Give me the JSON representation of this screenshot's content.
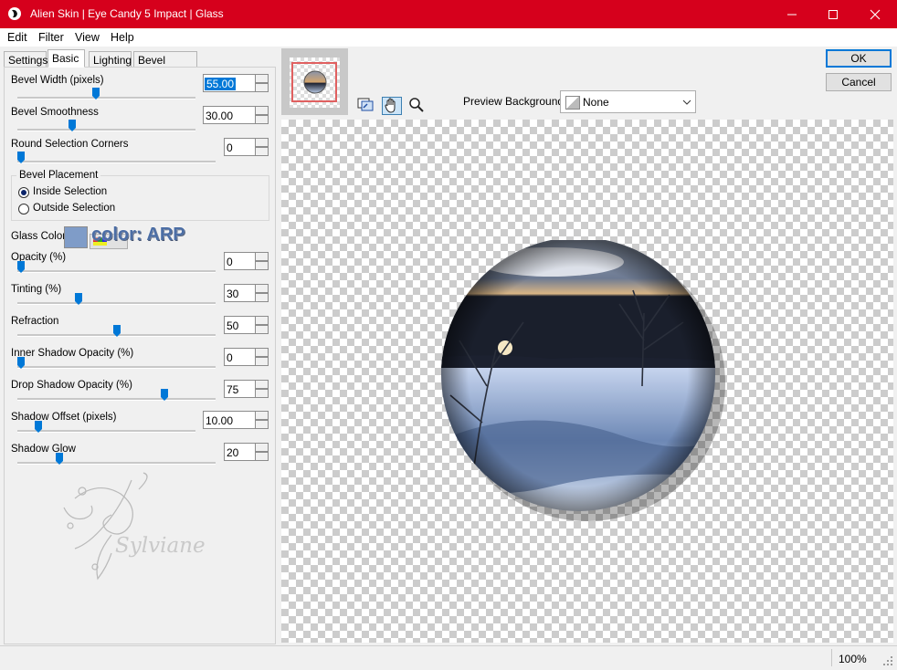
{
  "window": {
    "title": "Alien Skin | Eye Candy 5 Impact | Glass",
    "accent_color": "#d6001c",
    "icons": [
      "app-icon",
      "minimize-icon",
      "maximize-icon",
      "close-icon"
    ]
  },
  "menu": [
    "Edit",
    "Filter",
    "View",
    "Help"
  ],
  "tabs": [
    "Settings",
    "Basic",
    "Lighting",
    "Bevel Profile"
  ],
  "active_tab": "Basic",
  "params": {
    "bevel_width": {
      "label": "Bevel Width (pixels)",
      "value": "55.00"
    },
    "bevel_smoothness": {
      "label": "Bevel Smoothness",
      "value": "30.00"
    },
    "round_corners": {
      "label": "Round Selection Corners",
      "value": "0"
    },
    "opacity": {
      "label": "Opacity (%)",
      "value": "0"
    },
    "tinting": {
      "label": "Tinting (%)",
      "value": "30"
    },
    "refraction": {
      "label": "Refraction",
      "value": "50"
    },
    "inner_shadow": {
      "label": "Inner Shadow Opacity (%)",
      "value": "0"
    },
    "drop_shadow": {
      "label": "Drop Shadow Opacity (%)",
      "value": "75"
    },
    "shadow_offset": {
      "label": "Shadow Offset (pixels)",
      "value": "10.00"
    },
    "shadow_glow": {
      "label": "Shadow Glow",
      "value": "20"
    }
  },
  "slider_levels": {
    "bevel_width": 0.44,
    "bevel_smoothness": 0.3,
    "round_corners": 0.0,
    "opacity": 0.0,
    "tinting": 0.3,
    "refraction": 0.5,
    "inner_shadow": 0.0,
    "drop_shadow": 0.75,
    "shadow_offset": 0.1,
    "shadow_glow": 0.2
  },
  "placement": {
    "title": "Bevel Placement",
    "options": [
      "Inside Selection",
      "Outside Selection"
    ],
    "selected": "Inside Selection"
  },
  "glass_color": {
    "label": "Glass Color",
    "swatch": "#7f9cc8",
    "annotation": "color: ARP"
  },
  "watermark": "Sylviane",
  "preview": {
    "background_label": "Preview Background:",
    "background_value": "None",
    "tools": [
      "navigate-icon",
      "hand-icon",
      "zoom-icon"
    ]
  },
  "buttons": {
    "ok": "OK",
    "cancel": "Cancel"
  },
  "status": {
    "zoom": "100%"
  }
}
